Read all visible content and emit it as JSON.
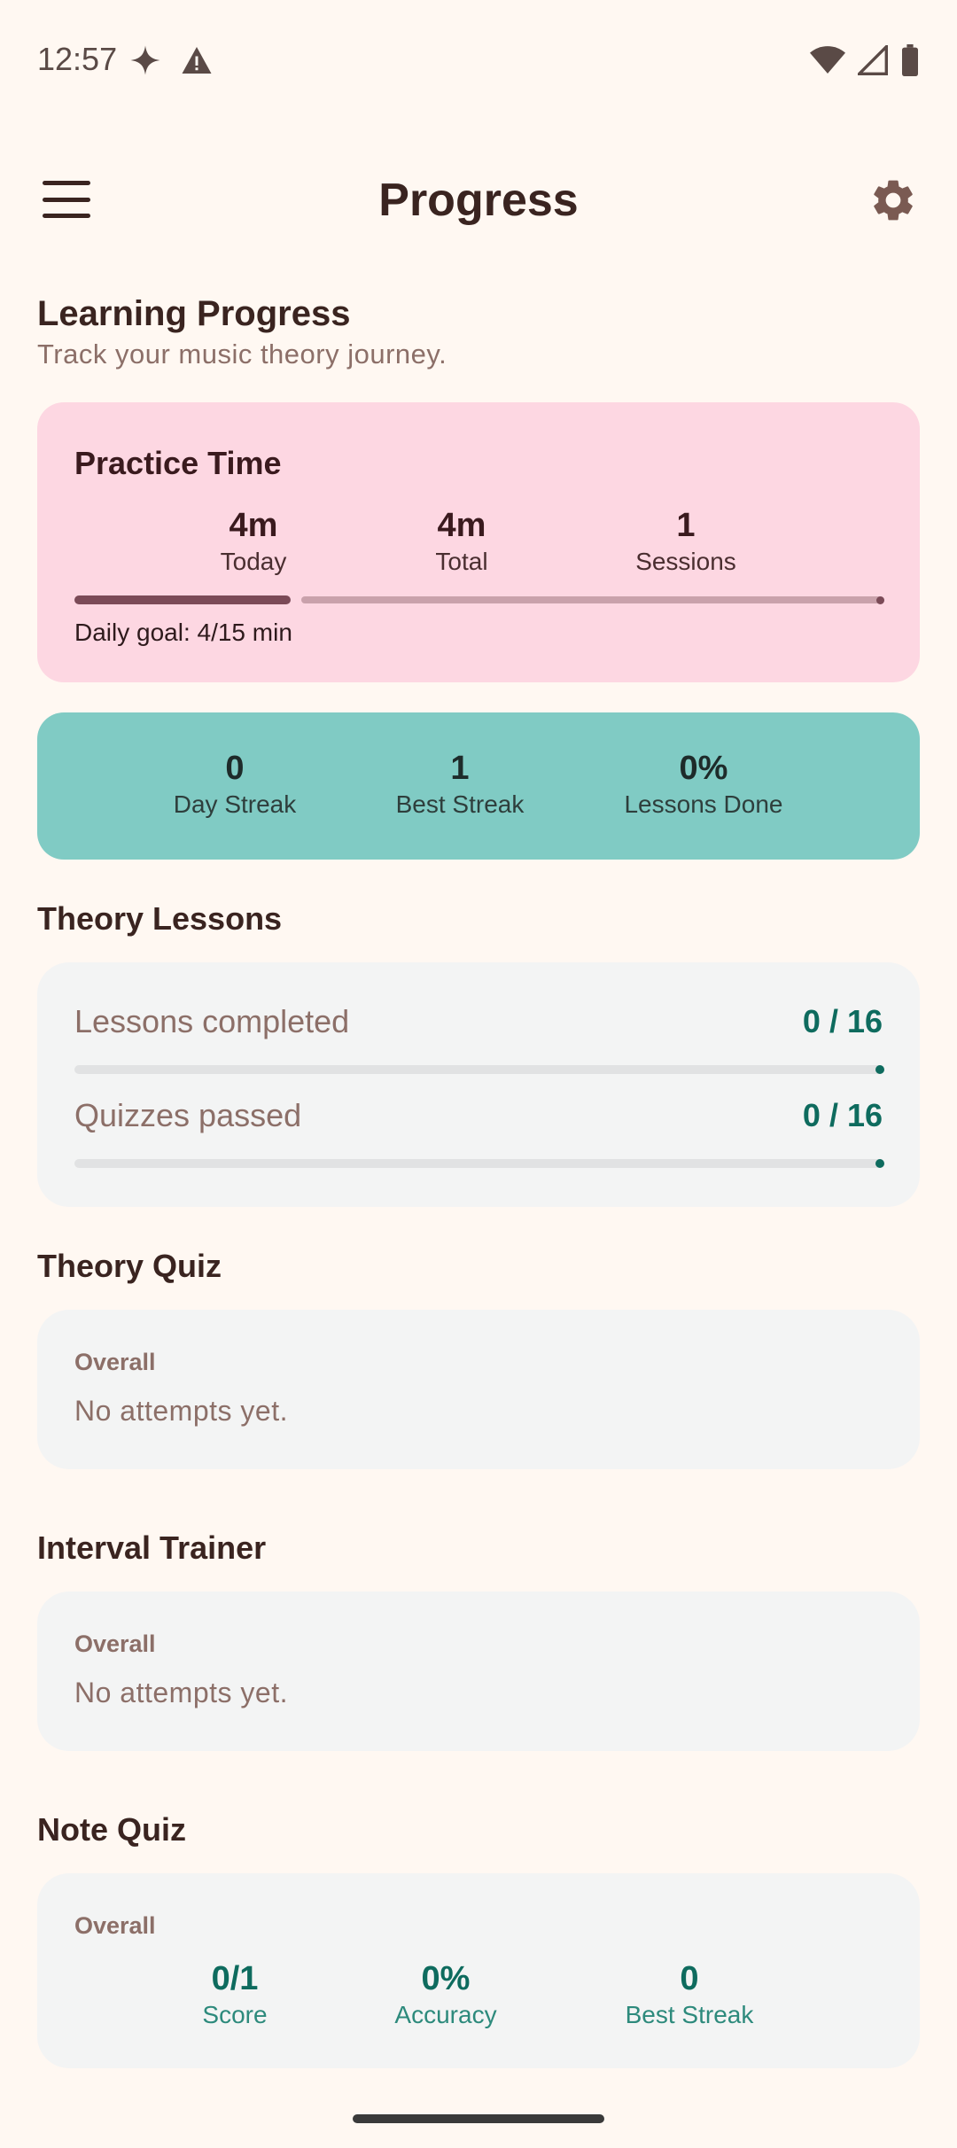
{
  "status_bar": {
    "time": "12:57",
    "icons": [
      "sparkle-icon",
      "warning-icon",
      "wifi-icon",
      "cellular-icon",
      "battery-icon"
    ]
  },
  "app_bar": {
    "title": "Progress",
    "menu_icon": "hamburger-menu-icon",
    "settings_icon": "gear-icon"
  },
  "header": {
    "title": "Learning Progress",
    "subtitle": "Track your music theory journey."
  },
  "practice_time": {
    "title": "Practice Time",
    "stats": [
      {
        "value": "4m",
        "label": "Today"
      },
      {
        "value": "4m",
        "label": "Total"
      },
      {
        "value": "1",
        "label": "Sessions"
      }
    ],
    "daily_goal_text": "Daily goal: 4/15 min",
    "daily_goal_progress": 0.267
  },
  "streaks": {
    "stats": [
      {
        "value": "0",
        "label": "Day Streak"
      },
      {
        "value": "1",
        "label": "Best Streak"
      },
      {
        "value": "0%",
        "label": "Lessons Done"
      }
    ]
  },
  "theory_lessons": {
    "title": "Theory Lessons",
    "rows": [
      {
        "label": "Lessons completed",
        "value": "0 / 16",
        "progress": 0
      },
      {
        "label": "Quizzes passed",
        "value": "0 / 16",
        "progress": 0
      }
    ]
  },
  "theory_quiz": {
    "title": "Theory Quiz",
    "overall_label": "Overall",
    "empty_text": "No attempts yet."
  },
  "interval_trainer": {
    "title": "Interval Trainer",
    "overall_label": "Overall",
    "empty_text": "No attempts yet."
  },
  "note_quiz": {
    "title": "Note Quiz",
    "overall_label": "Overall",
    "stats": [
      {
        "value": "0/1",
        "label": "Score"
      },
      {
        "value": "0%",
        "label": "Accuracy"
      },
      {
        "value": "0",
        "label": "Best Streak"
      }
    ]
  },
  "colors": {
    "background": "#FFF8F2",
    "practice_card": "#FDD7E2",
    "streak_card": "#80CBC4",
    "panel": "#F3F4F4",
    "accent_teal": "#0E6B5E"
  }
}
